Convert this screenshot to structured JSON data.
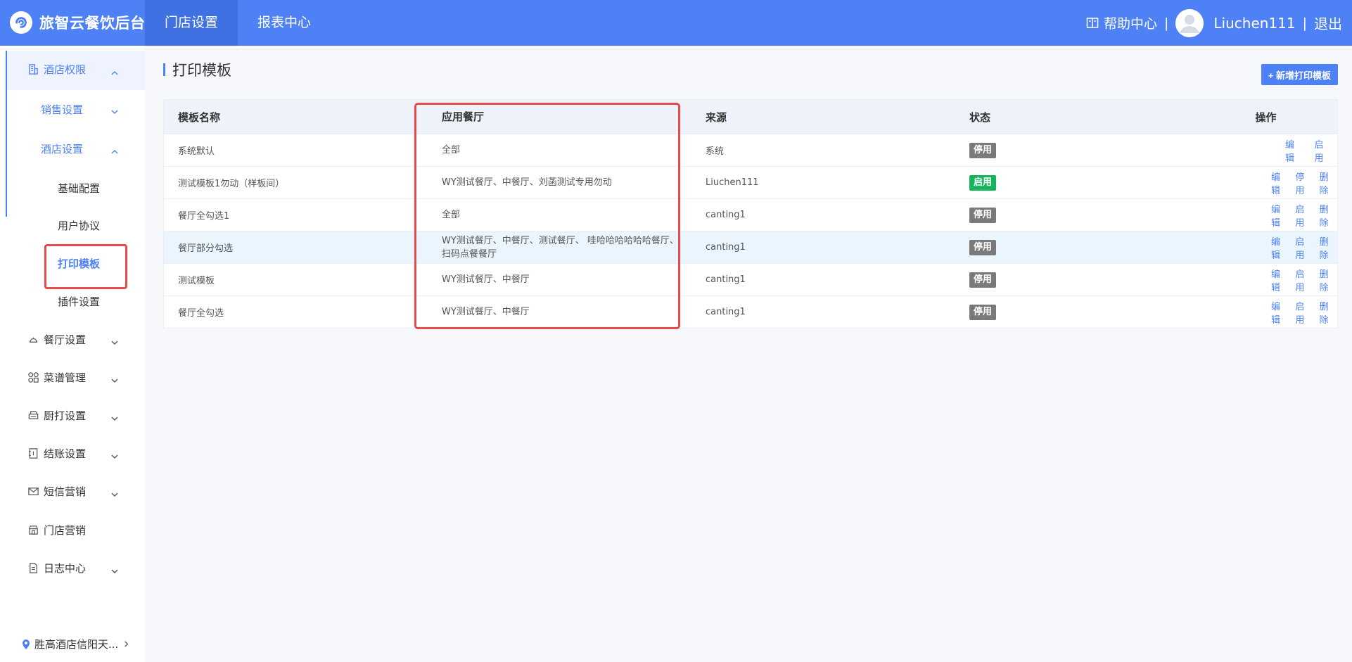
{
  "header": {
    "logo_text": "旅智云餐饮后台",
    "tabs": [
      {
        "label": "门店设置",
        "active": true
      },
      {
        "label": "报表中心",
        "active": false
      }
    ],
    "help_label": "帮助中心",
    "separator": "|",
    "username": "Liuchen111",
    "logout_label": "退出",
    "accent_color": "#4d81f5"
  },
  "sidebar": {
    "items": [
      {
        "label": "酒店权限",
        "icon": "building-icon",
        "expanded": true
      },
      {
        "label": "销售设置",
        "expanded": false
      },
      {
        "label": "酒店设置",
        "expanded": true
      },
      {
        "label": "基础配置"
      },
      {
        "label": "用户协议"
      },
      {
        "label": "打印模板",
        "active": true
      },
      {
        "label": "插件设置"
      },
      {
        "label": "餐厅设置",
        "icon": "restaurant-icon"
      },
      {
        "label": "菜谱管理",
        "icon": "grid-icon"
      },
      {
        "label": "厨打设置",
        "icon": "printer-icon"
      },
      {
        "label": "结账设置",
        "icon": "ledger-icon"
      },
      {
        "label": "短信营销",
        "icon": "mail-icon"
      },
      {
        "label": "门店营销",
        "icon": "store-icon"
      },
      {
        "label": "日志中心",
        "icon": "document-icon"
      }
    ],
    "store_name": "胜高酒店信阳天..."
  },
  "main": {
    "title": "打印模板",
    "add_button": "+ 新增打印模板",
    "table": {
      "columns": [
        "模板名称",
        "应用餐厅",
        "来源",
        "状态",
        "操作"
      ],
      "rows": [
        {
          "name": "系统默认",
          "restaurants": "全部",
          "source": "系统",
          "status": "停用",
          "status_on": false,
          "ops": [
            "编辑",
            "启用"
          ]
        },
        {
          "name": "测试模板1勿动（样板间）",
          "restaurants": "WY测试餐厅、中餐厅、刘菡测试专用勿动",
          "source": "Liuchen111",
          "status": "启用",
          "status_on": true,
          "ops": [
            "编辑",
            "停用",
            "删除"
          ]
        },
        {
          "name": "餐厅全勾选1",
          "restaurants": "全部",
          "source": "canting1",
          "status": "停用",
          "status_on": false,
          "ops": [
            "编辑",
            "启用",
            "删除"
          ]
        },
        {
          "name": "餐厅部分勾选",
          "restaurants": "WY测试餐厅、中餐厅、测试餐厅、 哇哈哈哈哈哈哈餐厅、扫码点餐餐厅",
          "source": "canting1",
          "status": "停用",
          "status_on": false,
          "ops": [
            "编辑",
            "启用",
            "删除"
          ],
          "highlighted": true
        },
        {
          "name": "测试模板",
          "restaurants": "WY测试餐厅、中餐厅",
          "source": "canting1",
          "status": "停用",
          "status_on": false,
          "ops": [
            "编辑",
            "启用",
            "删除"
          ]
        },
        {
          "name": "餐厅全勾选",
          "restaurants": "WY测试餐厅、中餐厅",
          "source": "canting1",
          "status": "停用",
          "status_on": false,
          "ops": [
            "编辑",
            "启用",
            "删除"
          ]
        }
      ]
    }
  }
}
